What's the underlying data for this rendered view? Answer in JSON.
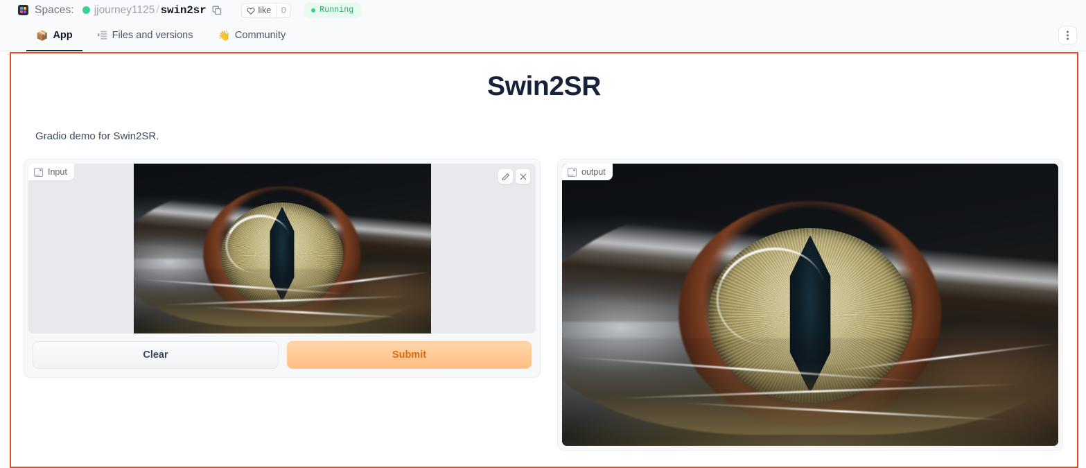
{
  "topbar": {
    "spaces_label": "Spaces:",
    "owner": "jjourney1125",
    "separator": "/",
    "repo": "swin2sr",
    "copy_icon": "copy-icon",
    "like_label": "like",
    "like_count": "0",
    "status_label": "Running",
    "status_color": "#2ea36a",
    "status_bg": "#e7faf0",
    "running_dot_color": "#3ccf8e",
    "owner_dot_color": "#36d399"
  },
  "tabs": [
    {
      "label": "App",
      "icon": "cube-icon",
      "glyph": "📦",
      "active": true
    },
    {
      "label": "Files and versions",
      "icon": "file-list-icon",
      "glyph": "☲",
      "active": false
    },
    {
      "label": "Community",
      "icon": "wave-hand-icon",
      "glyph": "👋",
      "active": false
    }
  ],
  "tabbar": {
    "overflow_menu_icon": "kebab-menu-icon"
  },
  "app": {
    "title": "Swin2SR",
    "description": "Gradio demo for Swin2SR.",
    "frame_border_color": "#e8491f",
    "input": {
      "label": "Input",
      "label_icon": "image-icon",
      "edit_icon": "pencil-icon",
      "clear_icon": "close-icon",
      "image_alt": "Close-up macro photo of a reptile eye with golden iris and vertical slit pupil above rippling water"
    },
    "output": {
      "label": "output",
      "label_icon": "image-icon",
      "image_alt": "Upscaled close-up of the same reptile eye, larger and smoother"
    },
    "buttons": {
      "clear": "Clear",
      "submit": "Submit",
      "submit_text_color": "#e0690f",
      "submit_bg_color": "#ffbe80"
    }
  }
}
